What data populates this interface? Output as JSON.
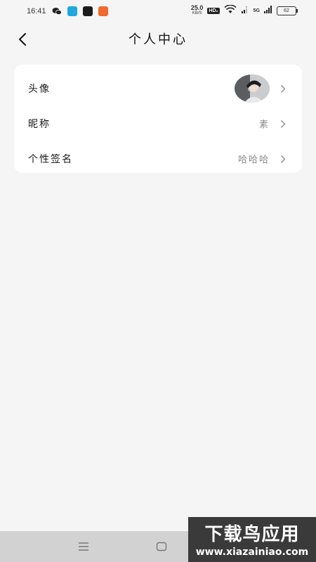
{
  "status_bar": {
    "time": "16:41",
    "net_speed": "25.0",
    "net_unit": "KB/S",
    "hd": "HD₂",
    "signal": "5G",
    "battery": "62"
  },
  "header": {
    "title": "个人中心"
  },
  "profile": {
    "rows": [
      {
        "label": "头像",
        "value": ""
      },
      {
        "label": "昵称",
        "value": "素"
      },
      {
        "label": "个性签名",
        "value": "哈哈哈"
      }
    ]
  },
  "watermark": {
    "title": "下载鸟应用",
    "url": "www.xiazainiao.com"
  },
  "colors": {
    "background": "#f5f5f5",
    "card": "#ffffff",
    "nav_bar": "#d2d2d2"
  }
}
